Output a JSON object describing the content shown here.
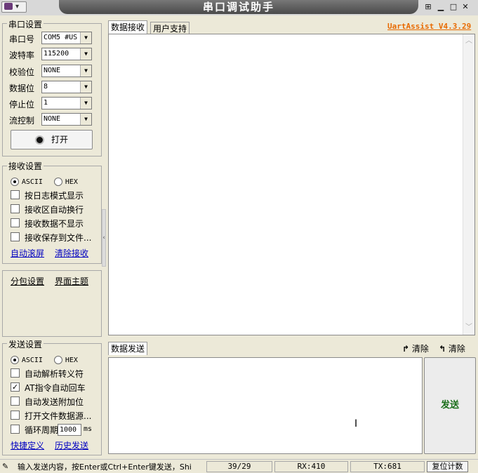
{
  "window": {
    "title": "串口调试助手",
    "brand": "UartAssist V4.3.29",
    "brand_color": "#e86a00"
  },
  "serial_settings": {
    "title": "串口设置",
    "fields": [
      {
        "label": "串口号",
        "value": "COM5 #US"
      },
      {
        "label": "波特率",
        "value": "115200"
      },
      {
        "label": "校验位",
        "value": "NONE"
      },
      {
        "label": "数据位",
        "value": "8"
      },
      {
        "label": "停止位",
        "value": "1"
      },
      {
        "label": "流控制",
        "value": "NONE"
      }
    ],
    "open_button": "打开"
  },
  "receive_settings": {
    "title": "接收设置",
    "mode_ascii": "ASCII",
    "mode_hex": "HEX",
    "mode_selected": "ASCII",
    "options": [
      {
        "label": "按日志模式显示",
        "checked": false
      },
      {
        "label": "接收区自动换行",
        "checked": false
      },
      {
        "label": "接收数据不显示",
        "checked": false
      },
      {
        "label": "接收保存到文件...",
        "checked": false
      }
    ],
    "auto_scroll": "自动滚屏",
    "clear_receive": "清除接收"
  },
  "extra_settings": {
    "packet": "分包设置",
    "theme": "界面主题"
  },
  "send_settings": {
    "title": "发送设置",
    "mode_ascii": "ASCII",
    "mode_hex": "HEX",
    "mode_selected": "ASCII",
    "options": [
      {
        "label": "自动解析转义符",
        "checked": false
      },
      {
        "label": "AT指令自动回车",
        "checked": true
      },
      {
        "label": "自动发送附加位",
        "checked": false
      },
      {
        "label": "打开文件数据源...",
        "checked": false
      }
    ],
    "cycle_label": "循环周期",
    "cycle_value": "1000",
    "cycle_unit": "ms",
    "cycle_checked": false,
    "shortcut": "快捷定义",
    "history": "历史发送"
  },
  "receive_area": {
    "tab_receive": "数据接收",
    "tab_support": "用户支持"
  },
  "send_area": {
    "tab_send": "数据发送",
    "clear1": "清除",
    "clear2": "清除",
    "send_button": "发送",
    "send_color": "#1a6e1a"
  },
  "status_bar": {
    "hint": "输入发送内容，按Enter或Ctrl+Enter键发送，Shi",
    "counter": "39/29",
    "rx": "RX:410",
    "tx": "TX:681",
    "reset": "复位计数"
  }
}
